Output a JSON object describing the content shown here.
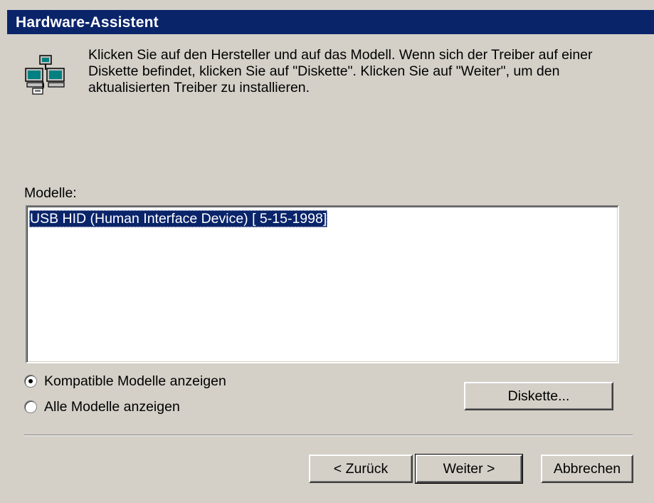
{
  "window": {
    "title": "Hardware-Assistent"
  },
  "instruction": "Klicken Sie auf den Hersteller und auf das Modell. Wenn sich der Treiber auf einer Diskette befindet, klicken Sie auf \"Diskette\". Klicken Sie auf \"Weiter\", um den aktualisierten Treiber zu installieren.",
  "icon": "hardware-wizard-icon",
  "models": {
    "label": "Modelle:",
    "items": [
      "USB HID (Human Interface Device) [ 5-15-1998]"
    ],
    "selected_index": 0
  },
  "options": {
    "compatible_label": "Kompatible Modelle anzeigen",
    "all_label": "Alle Modelle anzeigen",
    "selected": "compatible"
  },
  "buttons": {
    "disk": "Diskette...",
    "back": "< Zurück",
    "next": "Weiter >",
    "cancel": "Abbrechen"
  },
  "colors": {
    "title_bar": "#0a246a",
    "face": "#d4d0c8",
    "selection": "#0a246a"
  }
}
